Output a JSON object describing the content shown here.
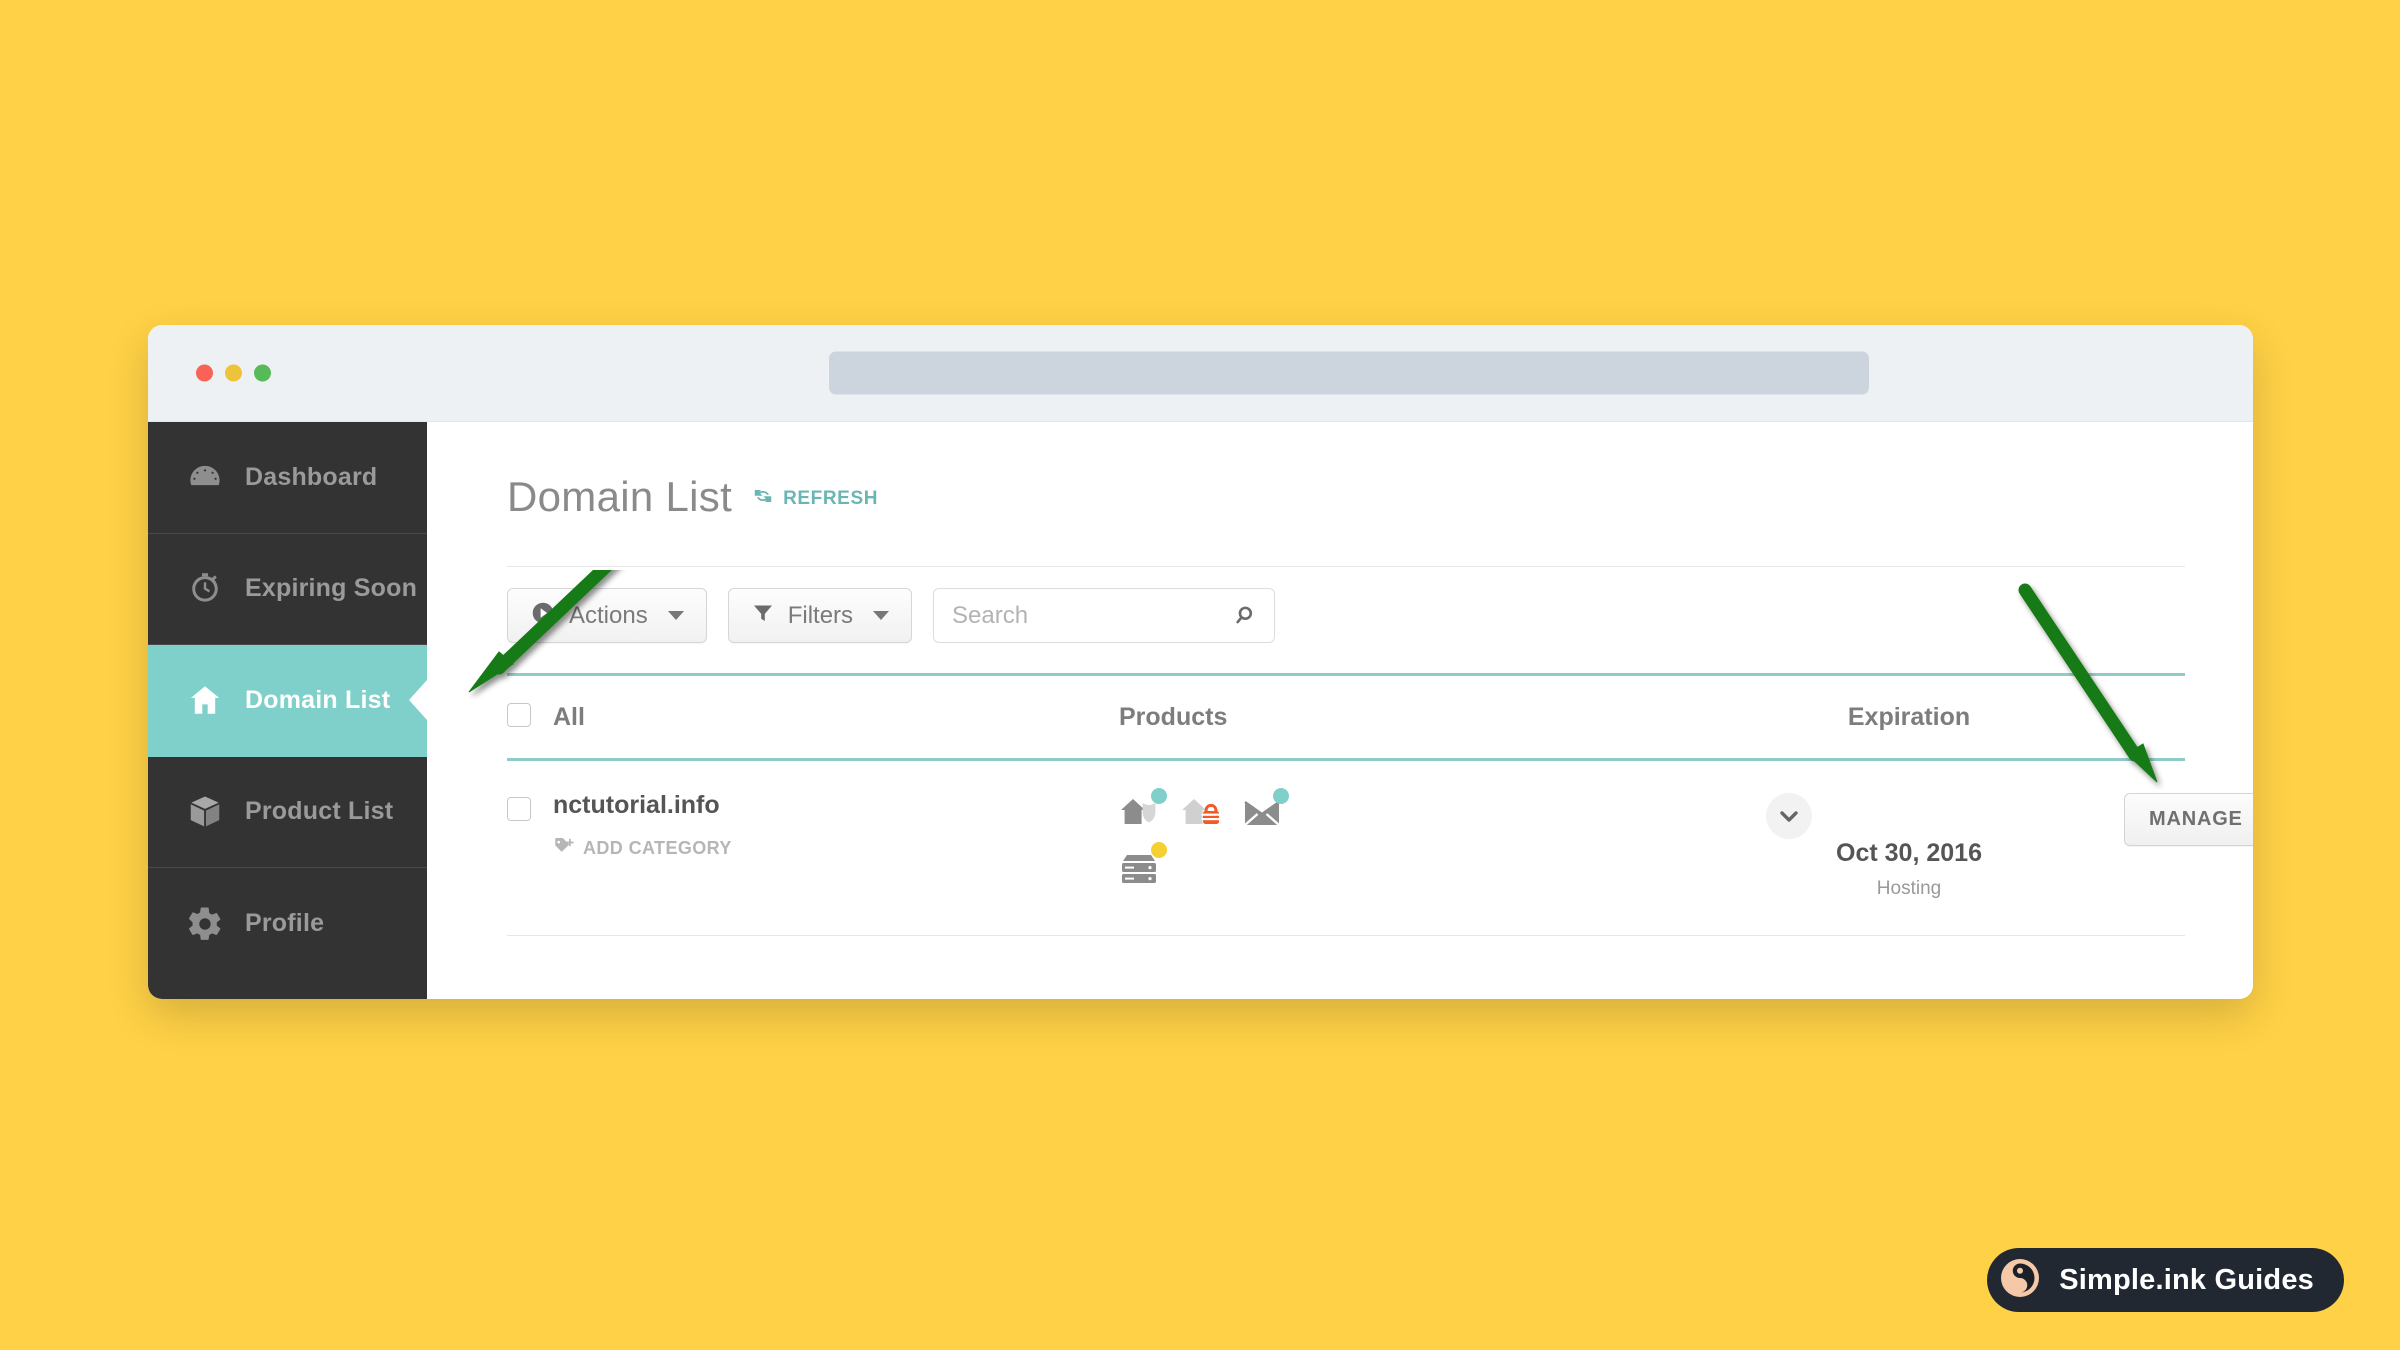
{
  "page": {
    "background_color": "#FFD146"
  },
  "browser": {
    "traffic_lights": [
      "close",
      "minimize",
      "maximize"
    ],
    "url_value": "",
    "url_placeholder": ""
  },
  "sidebar": {
    "background_color": "#333333",
    "active_color": "#7fcfca",
    "items": [
      {
        "label": "Dashboard",
        "icon": "speedometer-icon",
        "active": false
      },
      {
        "label": "Expiring Soon",
        "icon": "stopwatch-icon",
        "active": false
      },
      {
        "label": "Domain List",
        "icon": "home-icon",
        "active": true
      },
      {
        "label": "Product List",
        "icon": "box-icon",
        "active": false
      },
      {
        "label": "Profile",
        "icon": "gear-icon",
        "active": false
      }
    ]
  },
  "header": {
    "title": "Domain List",
    "refresh_label": "REFRESH",
    "refresh_icon": "refresh-icon",
    "refresh_color": "#6bb5b3"
  },
  "toolbar": {
    "actions_label": "Actions",
    "actions_icon": "play-circle-icon",
    "filters_label": "Filters",
    "filters_icon": "funnel-icon",
    "search_value": "",
    "search_placeholder": "Search",
    "search_icon": "search-icon"
  },
  "table": {
    "columns": {
      "select_all": "All",
      "products": "Products",
      "expiration": "Expiration",
      "action": ""
    },
    "rows": [
      {
        "selected": false,
        "domain": "nctutorial.info",
        "add_category_label": "ADD CATEGORY",
        "add_category_icon": "tag-plus-icon",
        "products": [
          {
            "name": "domain-privacy-icon",
            "dot_color": "#7fcfca"
          },
          {
            "name": "domain-ssl-icon",
            "dot_color": ""
          },
          {
            "name": "email-icon",
            "dot_color": "#7fcfca"
          },
          {
            "name": "hosting-server-icon",
            "dot_color": "#f5d032"
          }
        ],
        "expand_icon": "chevron-down-icon",
        "expiration_date": "Oct 30, 2016",
        "expiration_sub": "Hosting",
        "manage_label": "MANAGE"
      }
    ]
  },
  "annotations": {
    "arrows": [
      {
        "name": "arrow-pointing-to-domain-list",
        "color": "#1a7a1a"
      },
      {
        "name": "arrow-pointing-to-manage-button",
        "color": "#1a7a1a"
      }
    ]
  },
  "watermark": {
    "label": "Simple.ink Guides",
    "icon": "simple-ink-logo-icon",
    "background_color": "#222831",
    "logo_color": "#f5c9a8"
  }
}
